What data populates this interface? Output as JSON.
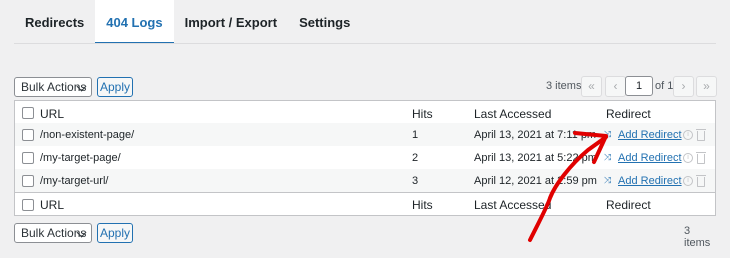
{
  "tabs": [
    {
      "label": "Redirects"
    },
    {
      "label": "404 Logs"
    },
    {
      "label": "Import / Export"
    },
    {
      "label": "Settings"
    }
  ],
  "top_bar": {
    "bulk_actions": "Bulk Actions",
    "apply": "Apply",
    "items_count": "3 items",
    "current_page": "1",
    "of_pages": "of 1",
    "first_icon": "«",
    "prev_icon": "‹",
    "next_icon": "›",
    "last_icon": "»"
  },
  "bottom_bar": {
    "bulk_actions": "Bulk Actions",
    "apply": "Apply",
    "items_count": "3 items"
  },
  "table": {
    "columns": {
      "url": "URL",
      "hits": "Hits",
      "last_accessed": "Last Accessed",
      "redirect": "Redirect"
    },
    "rows": [
      {
        "url": "/non-existent-page/",
        "hits": "1",
        "last_accessed": "April 13, 2021 at 7:11 pm",
        "action": "Add Redirect"
      },
      {
        "url": "/my-target-page/",
        "hits": "2",
        "last_accessed": "April 13, 2021 at 5:22 pm",
        "action": "Add Redirect"
      },
      {
        "url": "/my-target-url/",
        "hits": "3",
        "last_accessed": "April 12, 2021 at 2:59 pm",
        "action": "Add Redirect"
      }
    ]
  },
  "icons": {
    "redirect": "shuffle-icon",
    "info": "info-icon",
    "delete": "trash-icon"
  },
  "colors": {
    "accent": "#2271b1",
    "annotation_arrow": "#e00000",
    "background": "#f0f0f1"
  }
}
